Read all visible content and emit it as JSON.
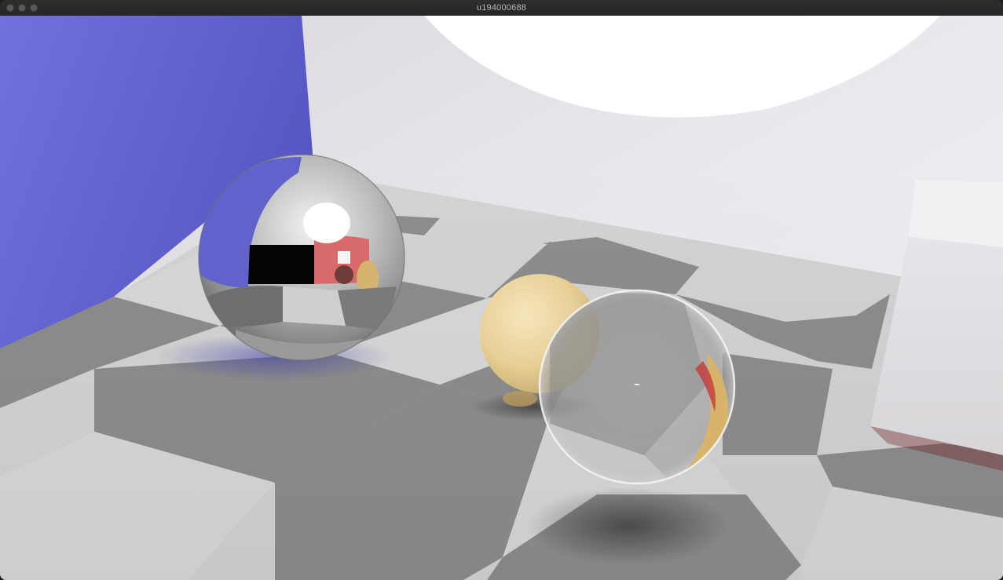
{
  "window": {
    "title": "u194000688",
    "controls": [
      "close-button",
      "minimize-button",
      "zoom-button"
    ]
  },
  "render": {
    "scene_objects": [
      "blue-wall",
      "white-back-wall",
      "area-light",
      "checkered-floor",
      "mirror-sphere",
      "diffuse-yellow-sphere",
      "glass-sphere",
      "white-box"
    ],
    "colors": {
      "wall_blue": "#6a6ad6",
      "back_wall": "#e4e2e8",
      "floor_light": "#d6d6d6",
      "floor_dark": "#8c8c8c",
      "yellow_sphere": "#e8d3a0",
      "light": "#ffffff"
    }
  }
}
